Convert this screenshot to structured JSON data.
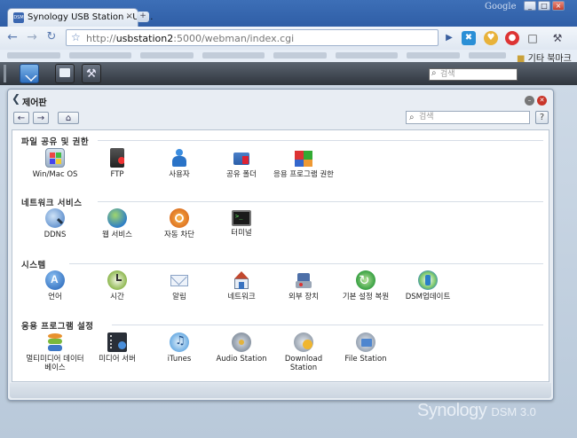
{
  "browser": {
    "tab_title": "Synology USB Station - US...",
    "tab_favicon": "DSM",
    "tab_close": "×",
    "new_tab": "+",
    "google_label": "Google",
    "url_host": "usbstation2",
    "url_prefix": "http://",
    "url_rest": ":5000/webman/index.cgi",
    "bookmark_other": "기타 북마크",
    "window_buttons": [
      "_",
      "□",
      "×"
    ]
  },
  "dsm": {
    "search_placeholder": "검색",
    "brand_name": "Synology",
    "brand_version": "DSM 3.0"
  },
  "window": {
    "title": "제어판",
    "search_placeholder": "검색",
    "help": "?"
  },
  "sections": [
    {
      "title": "파일 공유 및 권한",
      "items": [
        {
          "label": "Win/Mac OS",
          "icon": "win-mac-icon"
        },
        {
          "label": "FTP",
          "icon": "ftp-icon"
        },
        {
          "label": "사용자",
          "icon": "user-icon"
        },
        {
          "label": "공유 폴더",
          "icon": "shared-folder-icon"
        },
        {
          "label": "응용 프로그램 권한",
          "icon": "app-privileges-icon"
        }
      ]
    },
    {
      "title": "네트워크 서비스",
      "items": [
        {
          "label": "DDNS",
          "icon": "ddns-icon"
        },
        {
          "label": "웹 서비스",
          "icon": "web-services-icon"
        },
        {
          "label": "자동 차단",
          "icon": "auto-block-icon"
        },
        {
          "label": "터미널",
          "icon": "terminal-icon"
        }
      ]
    },
    {
      "title": "시스템",
      "items": [
        {
          "label": "언어",
          "icon": "language-icon"
        },
        {
          "label": "시간",
          "icon": "time-icon"
        },
        {
          "label": "알림",
          "icon": "notification-icon"
        },
        {
          "label": "네트워크",
          "icon": "network-icon"
        },
        {
          "label": "외부 장치",
          "icon": "external-device-icon"
        },
        {
          "label": "기본 설정 복원",
          "icon": "restore-defaults-icon"
        },
        {
          "label": "DSM업데이트",
          "icon": "dsm-update-icon"
        }
      ]
    },
    {
      "title": "응용 프로그램 설정",
      "items": [
        {
          "label": "멀티미디어 데이터 베이스",
          "icon": "media-index-icon"
        },
        {
          "label": "미디어 서버",
          "icon": "media-server-icon"
        },
        {
          "label": "iTunes",
          "icon": "itunes-icon"
        },
        {
          "label": "Audio Station",
          "icon": "audio-station-icon"
        },
        {
          "label": "Download Station",
          "icon": "download-station-icon"
        },
        {
          "label": "File Station",
          "icon": "file-station-icon"
        }
      ]
    }
  ]
}
